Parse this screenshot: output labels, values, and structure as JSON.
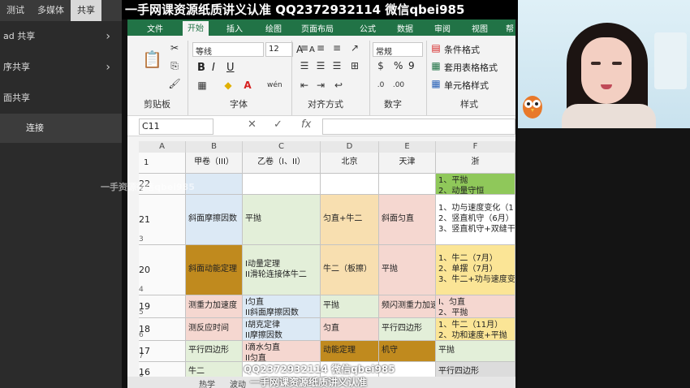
{
  "left_panel": {
    "tabs": [
      "测试",
      "多媒体",
      "共享"
    ],
    "active_tab": "共享",
    "items": [
      {
        "label": "ad 共享",
        "chevron": "›"
      },
      {
        "label": "序共享",
        "chevron": "›"
      },
      {
        "label": "面共享",
        "chevron": ""
      }
    ],
    "sub_item": "连接"
  },
  "watermark": {
    "top": "一手网课资源纸质讲义认准 QQ2372932114 微信qbei985",
    "mid": "一手资源微信qbei985",
    "bottom_line1": "QQ2372932114 微信qbei985",
    "bottom_line2": "一手网课资源纸质讲义认准"
  },
  "ribbon": {
    "tabs": [
      "文件",
      "开始",
      "插入",
      "绘图",
      "页面布局",
      "公式",
      "数据",
      "审阅",
      "视图",
      "帮"
    ],
    "active_tab": "开始",
    "font_name": "等线",
    "font_size": "12",
    "number_format": "常规",
    "style_buttons": [
      "条件格式",
      "套用表格格式",
      "单元格样式"
    ],
    "group_labels": [
      "剪贴板",
      "字体",
      "对齐方式",
      "数字",
      "样式"
    ],
    "bold": "B",
    "italic": "I",
    "underline": "U",
    "grow_font": "A",
    "shrink_font": "A",
    "percent": "%",
    "comma": "9"
  },
  "formula_bar": {
    "name_box": "C11",
    "cancel": "✕",
    "enter": "✓",
    "fx": "fx"
  },
  "columns": [
    "A",
    "B",
    "C",
    "D",
    "E",
    "F"
  ],
  "header_row": {
    "row": "1",
    "cells": [
      "甲卷（III）",
      "乙卷（I、II）",
      "北京",
      "天津",
      "浙"
    ]
  },
  "rows": [
    {
      "row": "2",
      "year": "22",
      "b": "",
      "c": "",
      "d": "",
      "e": "",
      "f": [
        "1、平抛",
        "2、动量守恒"
      ]
    },
    {
      "row": "3",
      "year": "21",
      "b": "斜面摩擦因数",
      "c": "平抛",
      "d": "匀直+牛二",
      "e": "斜面匀直",
      "f": [
        "1、功与速度变化（1",
        "2、竖直机守（6月）",
        "3、竖直机守+双缝干"
      ]
    },
    {
      "row": "4",
      "year": "20",
      "b": "斜面动能定理",
      "c": [
        "I动量定理",
        "II滑轮连接体牛二"
      ],
      "d": "牛二（板擦）",
      "e": "平抛",
      "f": [
        "1、牛二（7月）",
        "2、单摆（7月）",
        "3、牛二+功与速度变"
      ]
    },
    {
      "row": "5",
      "year": "19",
      "b": "测重力加速度",
      "c": [
        "I匀直",
        "II斜面摩擦因数"
      ],
      "d": "平抛",
      "e": "频闪测重力加速度",
      "f": [
        "I、匀直",
        "2、平抛"
      ]
    },
    {
      "row": "6",
      "year": "18",
      "b": "测反应时间",
      "c": [
        "I胡克定律",
        "II摩擦因数"
      ],
      "d": "匀直",
      "e": "平行四边形",
      "f": [
        "1、牛二（11月）",
        "2、功和速度+平抛"
      ]
    },
    {
      "row": "7",
      "year": "17",
      "b": "平行四边形",
      "c": [
        "I滴水匀直",
        "II匀直"
      ],
      "d": "动能定理",
      "e": "机守",
      "f": [
        "平抛"
      ]
    },
    {
      "row": "8",
      "year": "16",
      "b": "牛二",
      "c": "",
      "d": "",
      "e": "",
      "f": [
        "平行四边形"
      ]
    }
  ],
  "sheet_tabs": [
    "热学",
    "波动"
  ],
  "colors": {
    "excel_green": "#217346",
    "fill_blue": "#dce9f5",
    "fill_brown": "#c08a1e",
    "fill_orange": "#f8dfb0",
    "fill_pink": "#f5d7d0",
    "fill_green_light": "#e3efd9",
    "fill_green": "#8fc85a",
    "fill_yellow": "#fbe596"
  }
}
